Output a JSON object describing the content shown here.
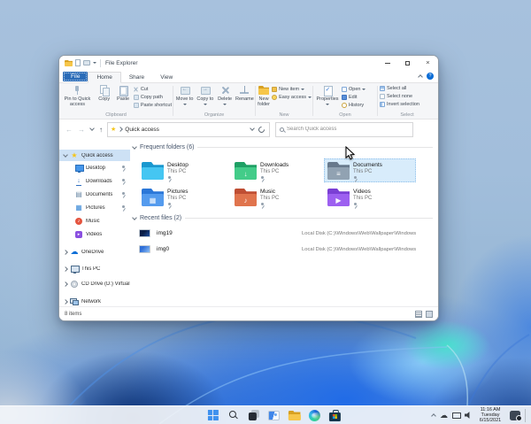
{
  "window": {
    "title": "File Explorer",
    "tabs": {
      "file": "File",
      "home": "Home",
      "share": "Share",
      "view": "View"
    },
    "ribbon": {
      "clipboard": {
        "label": "Clipboard",
        "pin": "Pin to Quick access",
        "copy": "Copy",
        "paste": "Paste",
        "cut": "Cut",
        "copy_path": "Copy path",
        "paste_shortcut": "Paste shortcut"
      },
      "organize": {
        "label": "Organize",
        "move_to": "Move to",
        "copy_to": "Copy to",
        "del": "Delete",
        "rename": "Rename"
      },
      "new_group": {
        "label": "New",
        "new_folder": "New folder",
        "new_item": "New item",
        "easy_access": "Easy access"
      },
      "open_group": {
        "label": "Open",
        "properties": "Properties",
        "open": "Open",
        "edit": "Edit",
        "history": "History"
      },
      "select_group": {
        "label": "Select",
        "select_all": "Select all",
        "select_none": "Select none",
        "invert_selection": "Invert selection"
      }
    },
    "address": {
      "location": "Quick access",
      "search_placeholder": "Search Quick access"
    },
    "sidebar": {
      "items": [
        {
          "label": "Quick access"
        },
        {
          "label": "Desktop"
        },
        {
          "label": "Downloads"
        },
        {
          "label": "Documents"
        },
        {
          "label": "Pictures"
        },
        {
          "label": "Music"
        },
        {
          "label": "Videos"
        },
        {
          "label": "OneDrive"
        },
        {
          "label": "This PC"
        },
        {
          "label": "CD Drive (D:) Virtual"
        },
        {
          "label": "Network"
        }
      ]
    },
    "main": {
      "frequent_header": "Frequent folders (6)",
      "recent_header": "Recent files (2)",
      "folders": [
        {
          "name": "Desktop",
          "location": "This PC",
          "back": "#1a98cf",
          "front": "#45c6f2",
          "glyph": ""
        },
        {
          "name": "Downloads",
          "location": "This PC",
          "back": "#1fa065",
          "front": "#43cc89",
          "glyph": "↓"
        },
        {
          "name": "Documents",
          "location": "This PC",
          "back": "#68798c",
          "front": "#91a2b2",
          "glyph": "≡"
        },
        {
          "name": "Pictures",
          "location": "This PC",
          "back": "#2b77d8",
          "front": "#549bee",
          "glyph": "▦"
        },
        {
          "name": "Music",
          "location": "This PC",
          "back": "#bf4e33",
          "front": "#e0744d",
          "glyph": "♪"
        },
        {
          "name": "Videos",
          "location": "This PC",
          "back": "#7a3fd4",
          "front": "#9d60f0",
          "glyph": "▶"
        }
      ],
      "files": [
        {
          "name": "img19",
          "path": "Local Disk (C:)\\Windows\\Web\\Wallpaper\\Windows"
        },
        {
          "name": "img0",
          "path": "Local Disk (C:)\\Windows\\Web\\Wallpaper\\Windows"
        }
      ]
    },
    "statusbar": {
      "items_count": "8 items"
    }
  },
  "taskbar": {
    "clock": {
      "time": "11:16 AM",
      "day": "Tuesday",
      "date": "6/15/2021"
    }
  },
  "icons": {
    "back_arrow": "←",
    "forward_arrow": "→",
    "up_arrow": "↑",
    "help_glyph": "?"
  },
  "colors": {
    "accent": "#0a6cd6",
    "file_tab_bg": "#2b6cb8",
    "selection_bg": "#d8ecfb",
    "sidebar_selected_bg": "#cde1f5",
    "taskbar_bg": "#f1f4f9"
  }
}
